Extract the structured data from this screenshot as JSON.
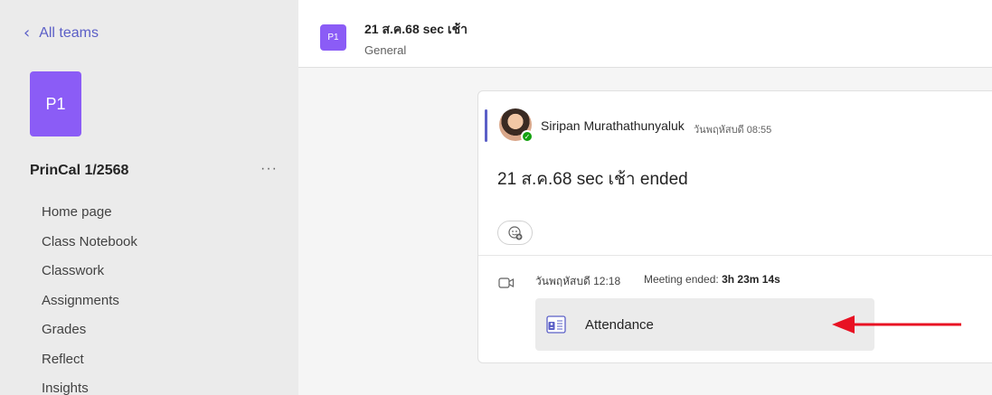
{
  "sidebar": {
    "back_label": "All teams",
    "team_avatar": "P1",
    "team_name": "PrinCal 1/2568",
    "more_label": "···",
    "nav": [
      {
        "label": "Home page"
      },
      {
        "label": "Class Notebook"
      },
      {
        "label": "Classwork"
      },
      {
        "label": "Assignments"
      },
      {
        "label": "Grades"
      },
      {
        "label": "Reflect"
      },
      {
        "label": "Insights"
      }
    ]
  },
  "header": {
    "avatar": "P1",
    "title": "21 ส.ค.68 sec เช้า",
    "channel": "General"
  },
  "message": {
    "sender": "Siripan Murathathunyaluk",
    "time": "วันพฤหัสบดี 08:55",
    "text": "21 ส.ค.68 sec เช้า ended",
    "meeting": {
      "time": "วันพฤหัสบดี 12:18",
      "label": "Meeting ended:",
      "duration": "3h 23m 14s"
    },
    "attendance_label": "Attendance"
  },
  "icons": {
    "back": "chevron-left-icon",
    "react": "emoji-add-icon",
    "camera": "video-camera-icon",
    "attendance": "attendance-document-icon",
    "annotation": "red-arrow-icon"
  },
  "colors": {
    "accent": "#5b5fc7",
    "avatar": "#8b5cf6",
    "arrow": "#e81123",
    "presence": "#13a10e"
  }
}
